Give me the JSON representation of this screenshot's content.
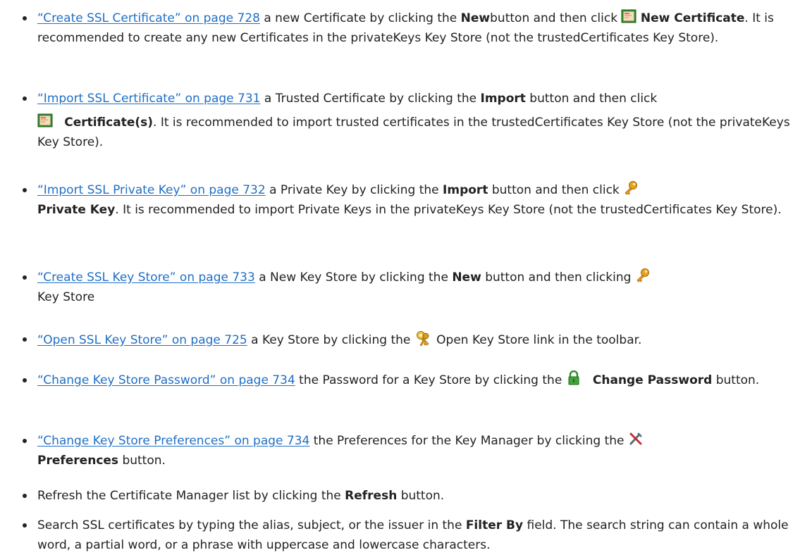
{
  "items": [
    {
      "link": "“Create SSL Certificate” on page 728",
      "t1": " a new Certificate by clicking the ",
      "b1": "New",
      "t2": "button and then click ",
      "icon": "certificate-icon",
      "b2": "New Certificate",
      "t3": ". It is recommended to create any new Certificates in the privateKeys Key Store (not the trustedCertificates Key Store)."
    },
    {
      "link": "“Import SSL Certificate” on page 731",
      "t1": " a Trusted Certificate by clicking the ",
      "b1": "Import",
      "t2": " button and then click",
      "icon": "certificate-icon",
      "b2": "Certificate(s)",
      "t3": ". It is recommended to import trusted certificates in the trustedCertificates Key Store (not the privateKeys Key Store)."
    },
    {
      "link": "“Import SSL Private Key” on page 732",
      "t1": " a Private Key by clicking the ",
      "b1": "Import",
      "t2": " button and then click ",
      "icon": "key-icon",
      "b2": "Private Key",
      "t3": ". It is recommended to import Private Keys in the privateKeys Key Store (not the trustedCertificates Key Store)."
    },
    {
      "link": "“Create SSL Key Store” on page 733",
      "t1": " a New Key Store by clicking the ",
      "b1": "New",
      "t2": " button and then clicking ",
      "icon": "key-icon",
      "t3": "Key Store"
    },
    {
      "link": "“Open SSL Key Store” on page 725",
      "t1": " a Key Store by clicking the ",
      "icon": "keys-icon",
      "t2": " Open Key Store link in the toolbar."
    },
    {
      "link": "“Change Key Store Password” on page 734",
      "t1": " the Password for a Key Store by clicking the ",
      "icon": "lock-icon",
      "b1": "Change Password",
      "t2": " button."
    },
    {
      "link": "“Change Key Store Preferences” on page 734",
      "t1": " the Preferences for the Key Manager by clicking the ",
      "icon": "tools-icon",
      "b1": "Preferences",
      "t2": " button."
    },
    {
      "t1": "Refresh the Certificate Manager list by clicking the ",
      "b1": "Refresh",
      "t2": " button."
    },
    {
      "t1": "Search SSL certificates by typing the alias, subject, or the issuer in the ",
      "b1": "Filter By",
      "t2": " field. The search string can contain a whole word, a partial word, or a phrase with uppercase and lowercase characters."
    }
  ],
  "colors": {
    "link": "#1f6fc5",
    "text": "#222222"
  }
}
